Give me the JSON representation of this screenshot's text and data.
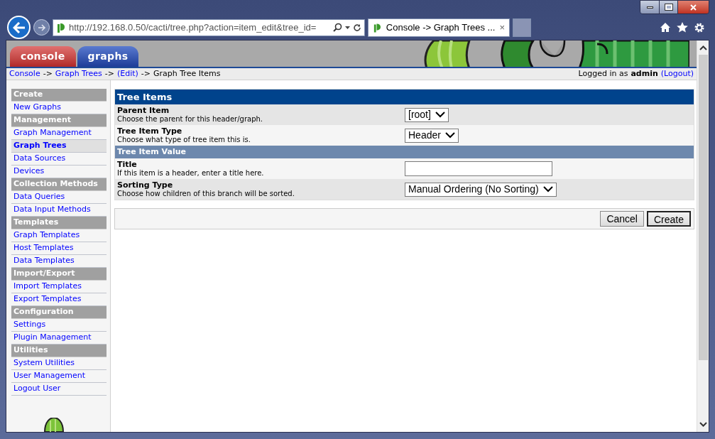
{
  "browser": {
    "address": "http://192.168.0.50/cacti/tree.php?action=item_edit&tree_id=",
    "tab_title": "Console -> Graph Trees ...",
    "tab_close": "×"
  },
  "header_tabs": [
    {
      "label": "console",
      "selected": true
    },
    {
      "label": "graphs",
      "selected": false
    }
  ],
  "breadcrumb": {
    "separator": "->",
    "items": [
      {
        "text": "Console",
        "link": true
      },
      {
        "text": "Graph Trees",
        "link": true
      },
      {
        "text": "(Edit)",
        "link": true
      },
      {
        "text": "Graph Tree Items",
        "link": false
      }
    ]
  },
  "login": {
    "prefix": "Logged in as",
    "user": "admin",
    "logout": "(Logout)"
  },
  "sidebar": [
    {
      "header": "Create",
      "items": [
        {
          "label": "New Graphs",
          "selected": false
        }
      ]
    },
    {
      "header": "Management",
      "items": [
        {
          "label": "Graph Management",
          "selected": false
        },
        {
          "label": "Graph Trees",
          "selected": true
        },
        {
          "label": "Data Sources",
          "selected": false
        },
        {
          "label": "Devices",
          "selected": false
        }
      ]
    },
    {
      "header": "Collection Methods",
      "items": [
        {
          "label": "Data Queries",
          "selected": false
        },
        {
          "label": "Data Input Methods",
          "selected": false
        }
      ]
    },
    {
      "header": "Templates",
      "items": [
        {
          "label": "Graph Templates",
          "selected": false
        },
        {
          "label": "Host Templates",
          "selected": false
        },
        {
          "label": "Data Templates",
          "selected": false
        }
      ]
    },
    {
      "header": "Import/Export",
      "items": [
        {
          "label": "Import Templates",
          "selected": false
        },
        {
          "label": "Export Templates",
          "selected": false
        }
      ]
    },
    {
      "header": "Configuration",
      "items": [
        {
          "label": "Settings",
          "selected": false
        },
        {
          "label": "Plugin Management",
          "selected": false
        }
      ]
    },
    {
      "header": "Utilities",
      "items": [
        {
          "label": "System Utilities",
          "selected": false
        },
        {
          "label": "User Management",
          "selected": false
        },
        {
          "label": "Logout User",
          "selected": false
        }
      ]
    }
  ],
  "form": {
    "title": "Tree Items",
    "rows": [
      {
        "kind": "field",
        "label": "Parent Item",
        "description": "Choose the parent for this header/graph.",
        "control": {
          "kind": "select",
          "value": "[root]"
        }
      },
      {
        "kind": "field",
        "label": "Tree Item Type",
        "description": "Choose what type of tree item this is.",
        "control": {
          "kind": "select",
          "value": "Header"
        }
      },
      {
        "kind": "section",
        "label": "Tree Item Value"
      },
      {
        "kind": "field",
        "label": "Title",
        "description": "If this item is a header, enter a title here.",
        "control": {
          "kind": "text"
        }
      },
      {
        "kind": "field",
        "label": "Sorting Type",
        "description": "Choose how children of this branch will be sorted.",
        "control": {
          "kind": "select",
          "value": "Manual Ordering (No Sorting)"
        }
      }
    ]
  },
  "buttons": [
    {
      "label": "Cancel",
      "default": false
    },
    {
      "label": "Create",
      "default": true
    }
  ]
}
